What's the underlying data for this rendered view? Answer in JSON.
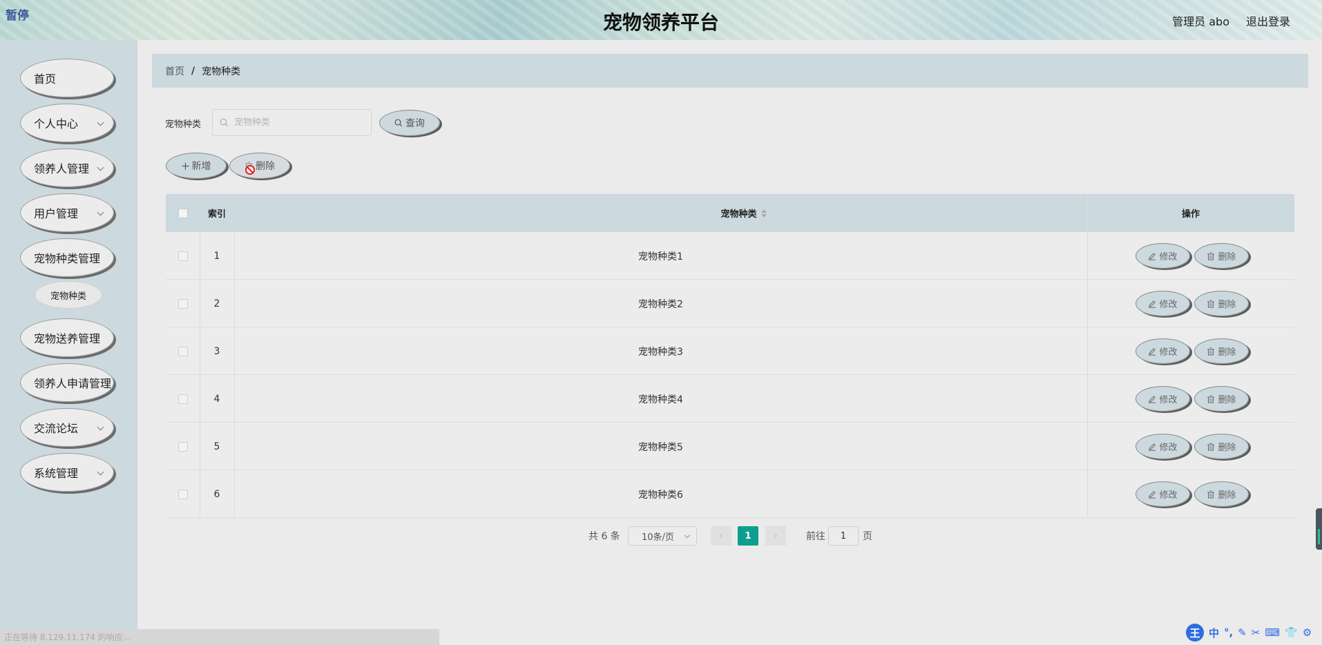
{
  "header": {
    "logo_text": "暂停",
    "title": "宠物领养平台",
    "admin_label": "管理员 abo",
    "logout": "退出登录"
  },
  "sidebar": {
    "items": [
      {
        "label": "首页"
      },
      {
        "label": "个人中心"
      },
      {
        "label": "领养人管理"
      },
      {
        "label": "用户管理"
      },
      {
        "label": "宠物种类管理"
      },
      {
        "label": "宠物送养管理"
      },
      {
        "label": "领养人申请管理"
      },
      {
        "label": "交流论坛"
      },
      {
        "label": "系统管理"
      }
    ],
    "sub_item": "宠物种类"
  },
  "breadcrumb": {
    "home": "首页",
    "sep": "/",
    "current": "宠物种类"
  },
  "search": {
    "label": "宠物种类",
    "placeholder": "宠物种类",
    "button": "查询"
  },
  "toolbar": {
    "add": "新增",
    "delete": "删除"
  },
  "table": {
    "headers": {
      "index": "索引",
      "category": "宠物种类",
      "actions": "操作"
    },
    "rows": [
      {
        "index": "1",
        "category": "宠物种类1"
      },
      {
        "index": "2",
        "category": "宠物种类2"
      },
      {
        "index": "3",
        "category": "宠物种类3"
      },
      {
        "index": "4",
        "category": "宠物种类4"
      },
      {
        "index": "5",
        "category": "宠物种类5"
      },
      {
        "index": "6",
        "category": "宠物种类6"
      }
    ],
    "edit_label": "修改",
    "delete_label": "删除"
  },
  "pagination": {
    "total": "共 6 条",
    "page_size": "10条/页",
    "current_page": "1",
    "goto_label": "前往",
    "goto_value": "1",
    "goto_unit": "页"
  },
  "statusbar": {
    "text": "正在等待 8.129.11.174 的响应..."
  },
  "ime": {
    "logo": "王",
    "items": [
      "中",
      "°,",
      "✎",
      "✂",
      "⌨",
      "👕",
      "⚙"
    ]
  },
  "colors": {
    "accent": "#0e9e8e",
    "panel": "#ccd9de",
    "background": "#ebebeb"
  }
}
